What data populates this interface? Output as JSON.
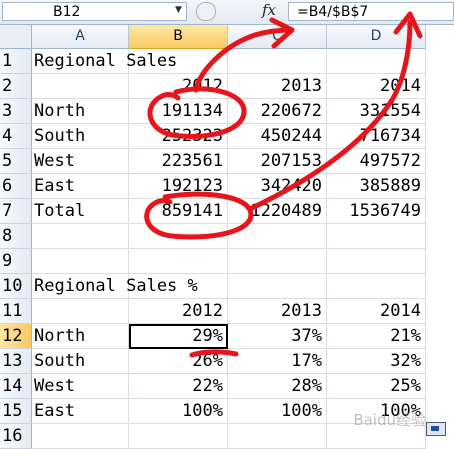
{
  "formula_bar": {
    "name_box": "B12",
    "fx_label": "fx",
    "formula": "=B4/$B$7"
  },
  "columns": [
    "A",
    "B",
    "C",
    "D"
  ],
  "active_column": "B",
  "rows": [
    {
      "n": "1",
      "cells": [
        "Regional Sales",
        "",
        "",
        ""
      ]
    },
    {
      "n": "2",
      "cells": [
        "",
        "2012",
        "2013",
        "2014"
      ]
    },
    {
      "n": "3",
      "cells": [
        "North",
        "191134",
        "220672",
        "331554"
      ]
    },
    {
      "n": "4",
      "cells": [
        "South",
        "252323",
        "450244",
        "716734"
      ]
    },
    {
      "n": "5",
      "cells": [
        "West",
        "223561",
        "207153",
        "497572"
      ]
    },
    {
      "n": "6",
      "cells": [
        "East",
        "192123",
        "342420",
        "385889"
      ]
    },
    {
      "n": "7",
      "cells": [
        "Total",
        "859141",
        "1220489",
        "1536749"
      ]
    },
    {
      "n": "8",
      "cells": [
        "",
        "",
        "",
        ""
      ]
    },
    {
      "n": "9",
      "cells": [
        "",
        "",
        "",
        ""
      ]
    },
    {
      "n": "10",
      "cells": [
        "Regional Sales %",
        "",
        "",
        ""
      ]
    },
    {
      "n": "11",
      "cells": [
        "",
        "2012",
        "2013",
        "2014"
      ]
    },
    {
      "n": "12",
      "cells": [
        "North",
        "29%",
        "37%",
        "21%"
      ]
    },
    {
      "n": "13",
      "cells": [
        "South",
        "26%",
        "17%",
        "32%"
      ]
    },
    {
      "n": "14",
      "cells": [
        "West",
        "22%",
        "28%",
        "25%"
      ]
    },
    {
      "n": "15",
      "cells": [
        "East",
        "100%",
        "100%",
        "100%"
      ]
    },
    {
      "n": "16",
      "cells": [
        "",
        "",
        "",
        ""
      ]
    }
  ],
  "active_row": "12",
  "watermark": "Baidu经验",
  "colors": {
    "annotation_red": "#e8141b",
    "active_header": "#f7c95f"
  }
}
